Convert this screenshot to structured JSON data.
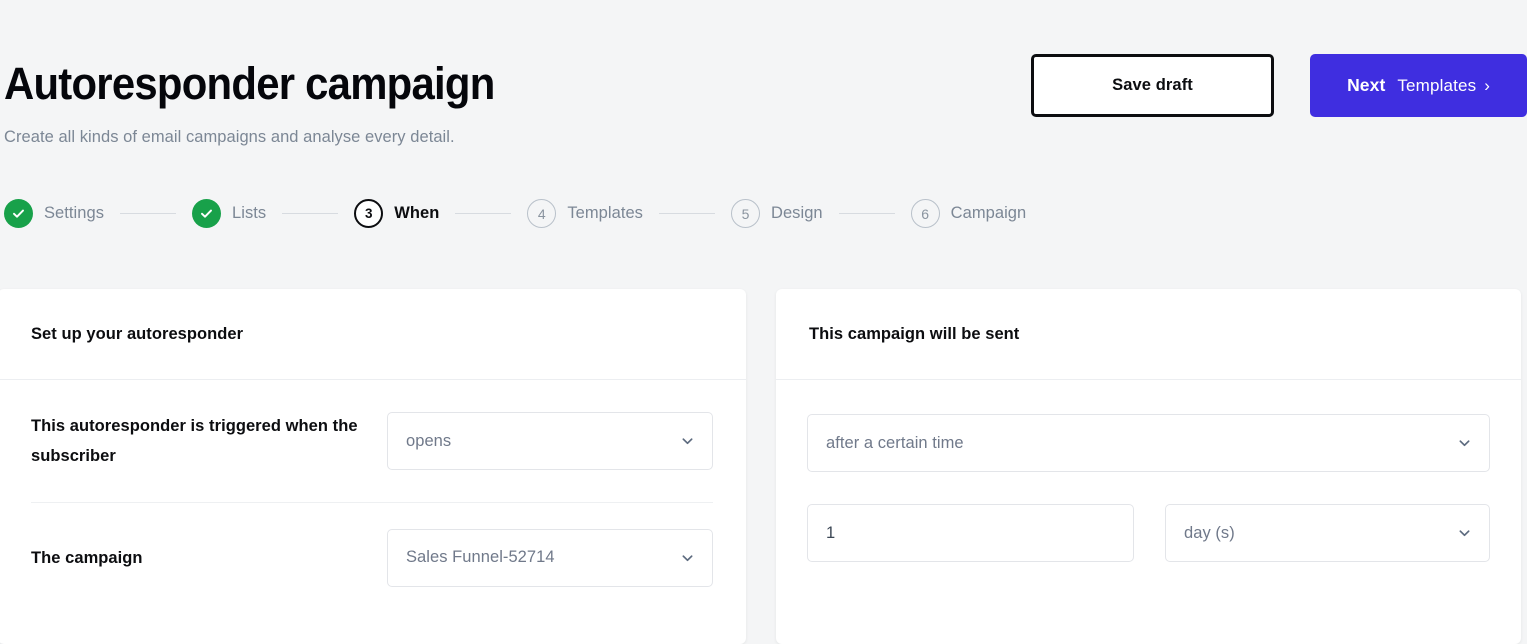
{
  "header": {
    "title": "Autoresponder campaign",
    "subtitle": "Create all kinds of email campaigns and analyse every detail.",
    "save_draft_label": "Save draft",
    "next_word": "Next",
    "next_target": "Templates",
    "next_chevron": "›"
  },
  "stepper": {
    "steps": [
      {
        "number": "1",
        "label": "Settings",
        "state": "done"
      },
      {
        "number": "2",
        "label": "Lists",
        "state": "done"
      },
      {
        "number": "3",
        "label": "When",
        "state": "active"
      },
      {
        "number": "4",
        "label": "Templates",
        "state": "todo"
      },
      {
        "number": "5",
        "label": "Design",
        "state": "todo"
      },
      {
        "number": "6",
        "label": "Campaign",
        "state": "todo"
      }
    ]
  },
  "left_card": {
    "title": "Set up your autoresponder",
    "trigger_label": "This autoresponder is triggered when the subscriber",
    "trigger_value": "opens",
    "campaign_label": "The campaign",
    "campaign_value": "Sales Funnel-52714"
  },
  "right_card": {
    "title": "This campaign will be sent",
    "timing_value": "after a certain time",
    "amount_value": "1",
    "unit_value": "day (s)"
  },
  "colors": {
    "accent_purple": "#3f2ee0",
    "success_green": "#18a14a",
    "page_background": "#f4f5f6",
    "card_background": "#ffffff",
    "text_primary": "#0c0d10",
    "text_muted": "#7c8795",
    "border": "#e3e5e9"
  }
}
